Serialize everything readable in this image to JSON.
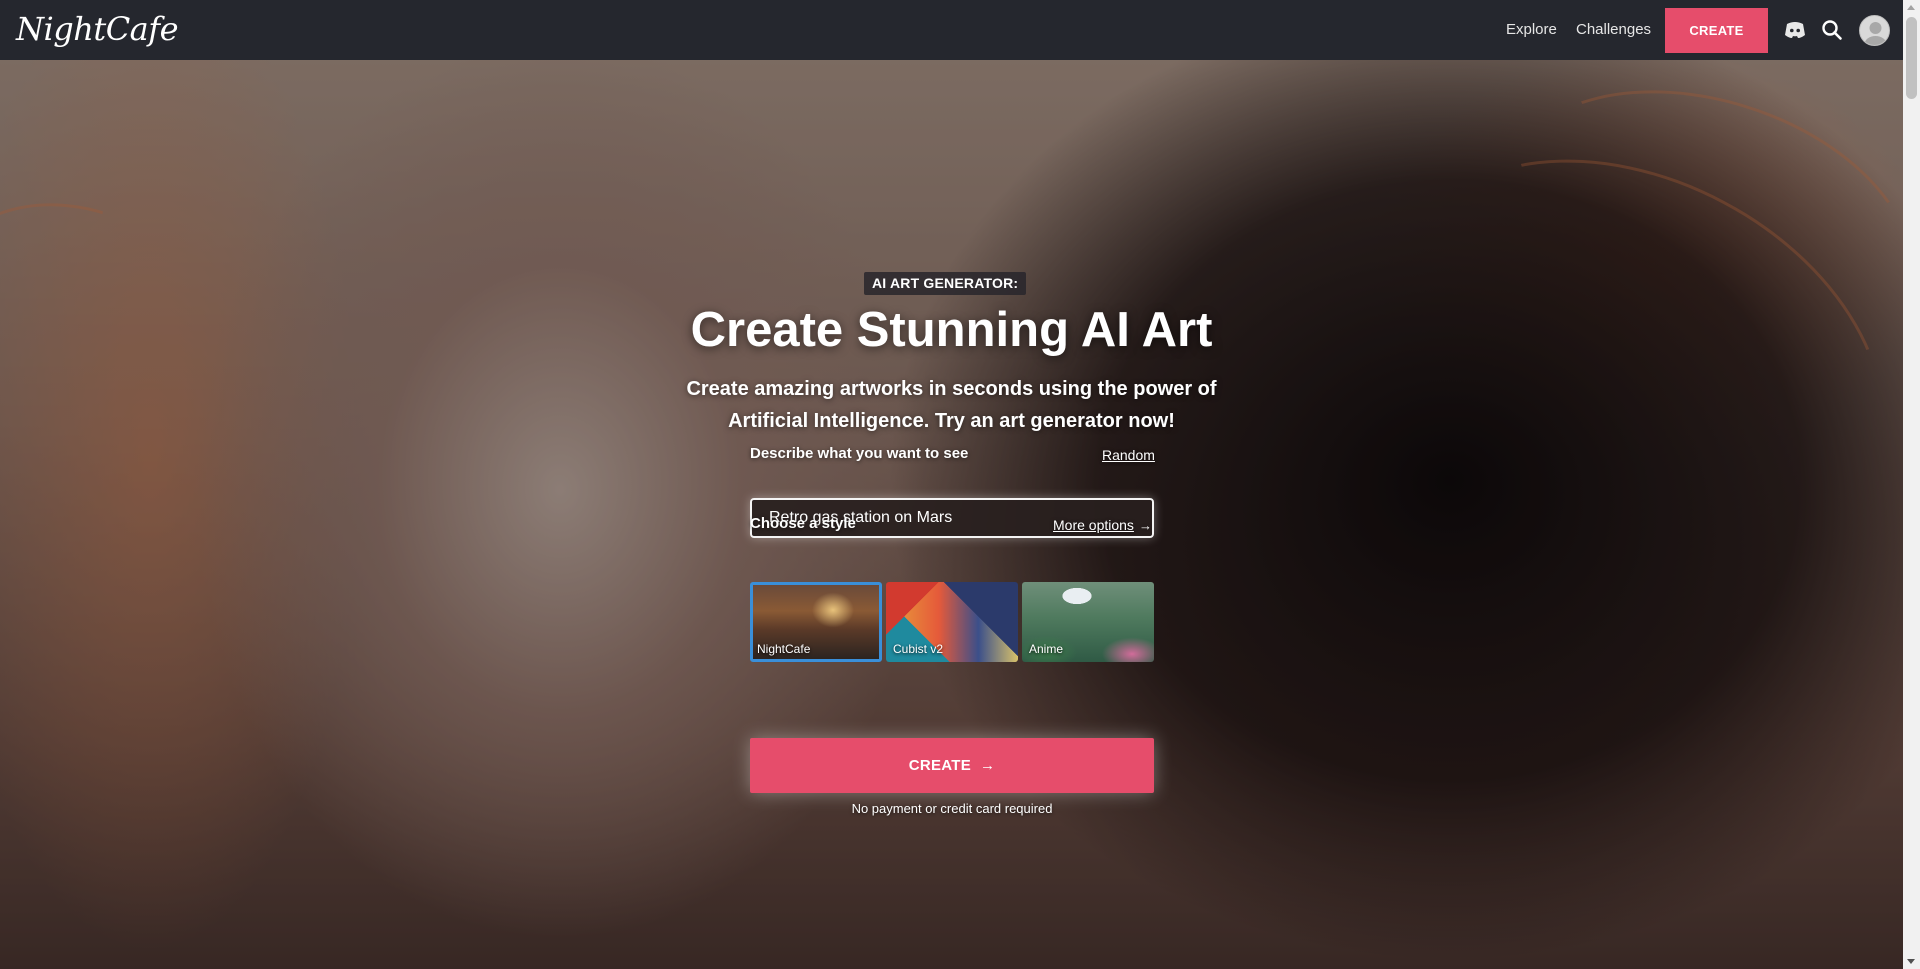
{
  "header": {
    "logo_text": "NightCafe",
    "nav": {
      "explore": "Explore",
      "challenges": "Challenges"
    },
    "create_label": "CREATE",
    "icons": [
      "discord-icon",
      "search-icon",
      "avatar"
    ]
  },
  "hero": {
    "eyebrow": "AI ART GENERATOR:",
    "title": "Create Stunning AI Art",
    "subtitle": "Create amazing artworks in seconds using the power of Artificial Intelligence. Try an art generator now!",
    "prompt": {
      "label": "Describe what you want to see",
      "random_link": "Random",
      "value": "Retro gas station on Mars"
    },
    "style": {
      "label": "Choose a style",
      "more_link": "More options",
      "options": [
        {
          "label": "NightCafe",
          "selected": true
        },
        {
          "label": "Cubist v2",
          "selected": false
        },
        {
          "label": "Anime",
          "selected": false
        }
      ]
    },
    "create_button": "CREATE",
    "footnote": "No payment or credit card required"
  },
  "colors": {
    "topbar_bg": "#25272e",
    "accent": "#e64d6b",
    "selected_outline": "#3a8fd9"
  }
}
